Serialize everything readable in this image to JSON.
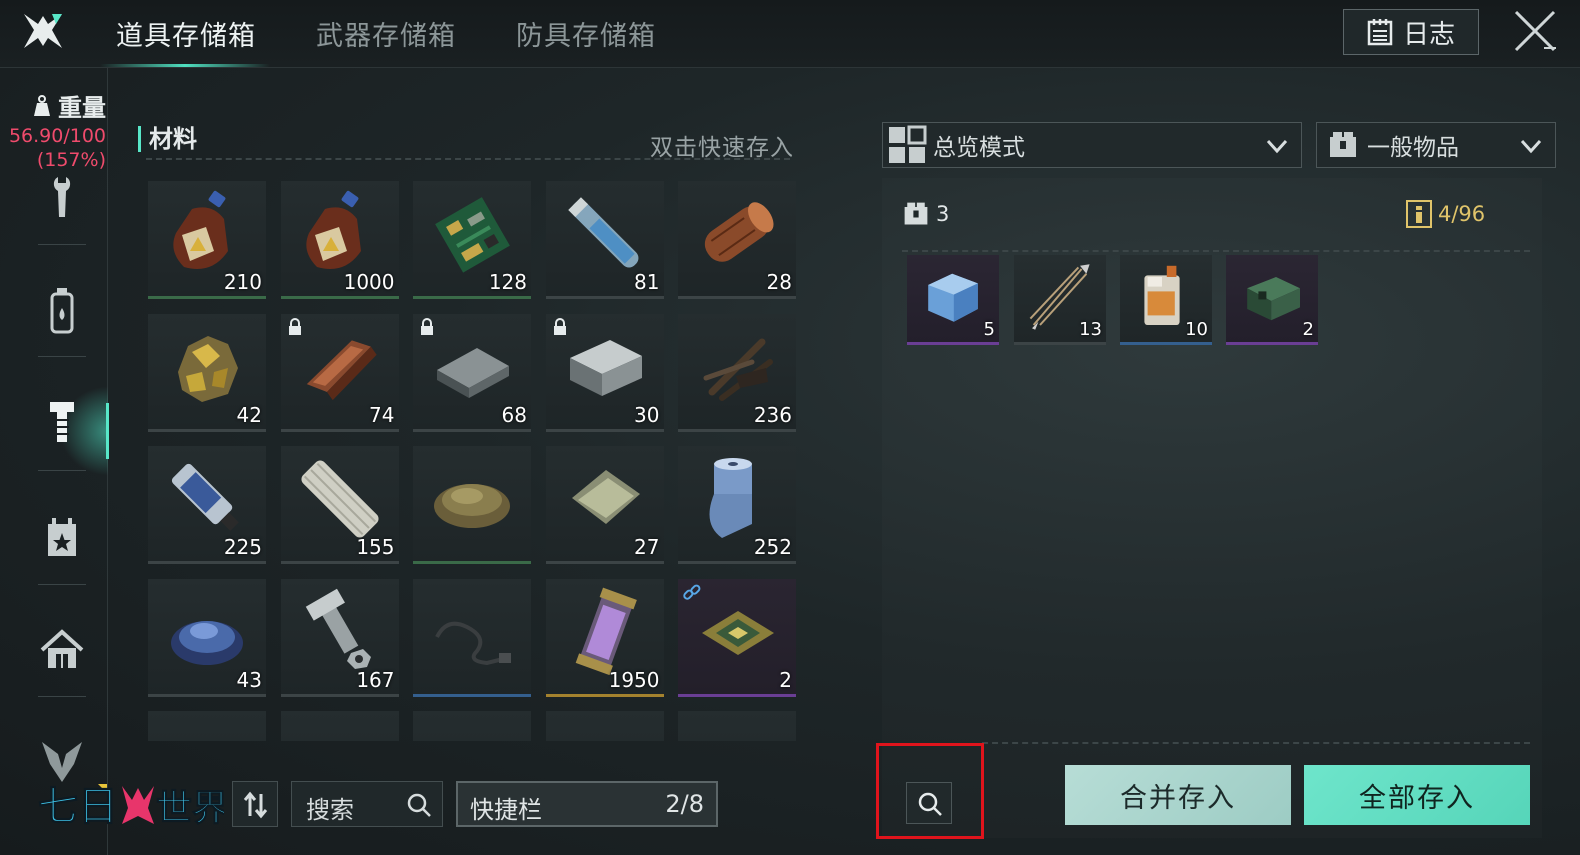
{
  "topbar": {
    "tabs": [
      {
        "label": "道具存储箱",
        "active": true
      },
      {
        "label": "武器存储箱",
        "active": false
      },
      {
        "label": "防具存储箱",
        "active": false
      }
    ],
    "log_label": "日志",
    "accent_color": "#58e7c8"
  },
  "sidebar": {
    "weight_label": "重量",
    "weight_value": "56.90/100",
    "weight_percent": "(157%)",
    "weight_color": "#ef4b6c",
    "items": [
      {
        "icon": "wrench-icon"
      },
      {
        "icon": "bottle-icon"
      },
      {
        "icon": "bolt-icon",
        "active": true
      },
      {
        "icon": "calendar-star-icon"
      },
      {
        "icon": "house-icon"
      },
      {
        "icon": "emblem-icon"
      }
    ]
  },
  "materials": {
    "title": "材料",
    "hint": "双击快速存入",
    "items": [
      {
        "icon": "brown-bottle-icon",
        "qty": "210",
        "rarity": "green"
      },
      {
        "icon": "brown-bottle-icon",
        "qty": "1000",
        "rarity": "green"
      },
      {
        "icon": "circuit-board-icon",
        "qty": "128",
        "rarity": "green"
      },
      {
        "icon": "glass-tube-icon",
        "qty": "81",
        "rarity": "common"
      },
      {
        "icon": "wood-log-icon",
        "qty": "28",
        "rarity": "common"
      },
      {
        "icon": "ore-nugget-icon",
        "qty": "42",
        "rarity": "common"
      },
      {
        "icon": "copper-ingot-icon",
        "qty": "74",
        "rarity": "common",
        "locked": true
      },
      {
        "icon": "steel-plate-icon",
        "qty": "68",
        "rarity": "common",
        "locked": true
      },
      {
        "icon": "metal-block-icon",
        "qty": "30",
        "rarity": "common",
        "locked": true
      },
      {
        "icon": "sticks-bark-icon",
        "qty": "236",
        "rarity": "common"
      },
      {
        "icon": "glue-tube-icon",
        "qty": "225",
        "rarity": "common"
      },
      {
        "icon": "cloth-roll-icon",
        "qty": "155",
        "rarity": "common"
      },
      {
        "icon": "fiber-pile-icon",
        "qty": "",
        "rarity": "green"
      },
      {
        "icon": "paper-sheets-icon",
        "qty": "27",
        "rarity": "common"
      },
      {
        "icon": "fabric-roll-icon",
        "qty": "252",
        "rarity": "common"
      },
      {
        "icon": "blue-crystals-icon",
        "qty": "43",
        "rarity": "common"
      },
      {
        "icon": "bolt-nut-icon",
        "qty": "167",
        "rarity": "common"
      },
      {
        "icon": "cable-icon",
        "qty": "",
        "rarity": "blue"
      },
      {
        "icon": "energy-canister-icon",
        "qty": "1950",
        "rarity": "gold"
      },
      {
        "icon": "chip-icon",
        "qty": "2",
        "rarity": "purple",
        "linked": true
      },
      {
        "icon": "stone-icon",
        "qty": "",
        "rarity": "common"
      },
      {
        "icon": "empty-icon",
        "qty": "",
        "rarity": "common"
      },
      {
        "icon": "empty-icon",
        "qty": "",
        "rarity": "common"
      },
      {
        "icon": "empty-icon",
        "qty": "",
        "rarity": "common"
      },
      {
        "icon": "empty-icon",
        "qty": "",
        "rarity": "common"
      }
    ]
  },
  "bottom_left": {
    "brand": "七日世界",
    "search_label": "搜索",
    "hotbar_label": "快捷栏",
    "hotbar_count": "2/8"
  },
  "storage": {
    "view_mode": "总览模式",
    "category": "一般物品",
    "box_count": "3",
    "capacity": "4/96",
    "items": [
      {
        "icon": "ice-cube-icon",
        "qty": "5",
        "rarity": "purple"
      },
      {
        "icon": "arrows-icon",
        "qty": "13",
        "rarity": "common"
      },
      {
        "icon": "fuel-jug-icon",
        "qty": "10",
        "rarity": "blue"
      },
      {
        "icon": "green-device-icon",
        "qty": "2",
        "rarity": "purple"
      }
    ],
    "merge_label": "合并存入",
    "deposit_all_label": "全部存入"
  }
}
